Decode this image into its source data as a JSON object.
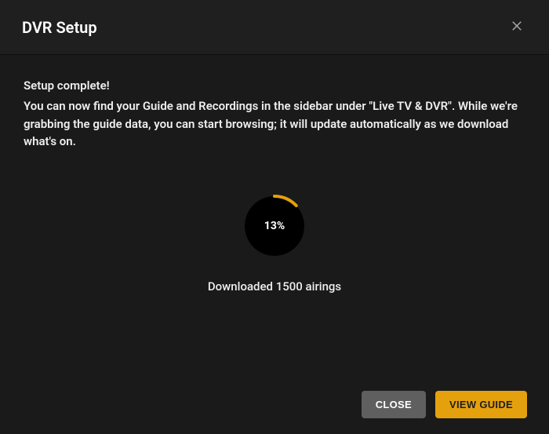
{
  "modal": {
    "title": "DVR Setup",
    "completeHeading": "Setup complete!",
    "completeDescription": "You can now find your Guide and Recordings in the sidebar under \"Live TV & DVR\". While we're grabbing the guide data, you can start browsing; it will update automatically as we download what's on."
  },
  "progress": {
    "percent": 13,
    "percentLabel": "13%",
    "statusText": "Downloaded 1500 airings"
  },
  "buttons": {
    "close": "CLOSE",
    "viewGuide": "VIEW GUIDE"
  },
  "colors": {
    "accent": "#e5a00d",
    "background": "#1a1a1a",
    "headerBackground": "#1f1f1f"
  }
}
